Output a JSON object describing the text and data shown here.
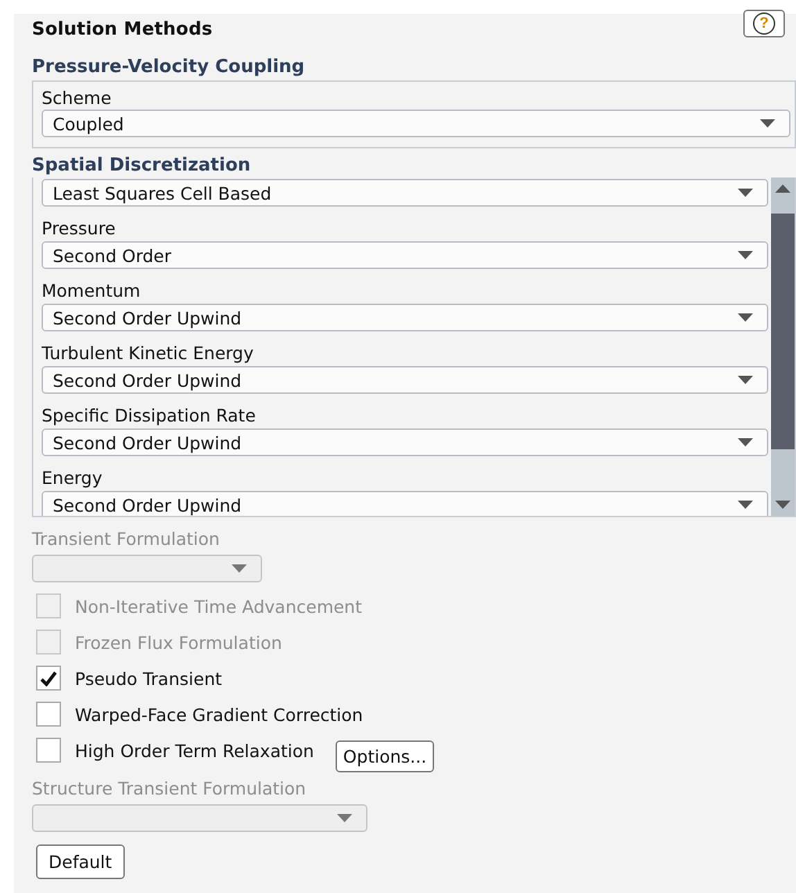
{
  "panel": {
    "title": "Solution Methods",
    "help_button": "?"
  },
  "pressure_velocity_coupling": {
    "heading": "Pressure-Velocity Coupling",
    "scheme": {
      "label": "Scheme",
      "value": "Coupled"
    }
  },
  "spatial_discretization": {
    "heading": "Spatial Discretization",
    "fields": [
      {
        "value": "Least Squares Cell Based"
      },
      {
        "label": "Pressure",
        "value": "Second Order"
      },
      {
        "label": "Momentum",
        "value": "Second Order Upwind"
      },
      {
        "label": "Turbulent Kinetic Energy",
        "value": "Second Order Upwind"
      },
      {
        "label": "Specific Dissipation Rate",
        "value": "Second Order Upwind"
      },
      {
        "label": "Energy",
        "value": "Second Order Upwind"
      }
    ]
  },
  "transient_formulation": {
    "label": "Transient Formulation",
    "disabled": true
  },
  "options": [
    {
      "label": "Non-Iterative Time Advancement",
      "checked": false,
      "disabled": true
    },
    {
      "label": "Frozen Flux Formulation",
      "checked": false,
      "disabled": true
    },
    {
      "label": "Pseudo Transient",
      "checked": true,
      "disabled": false
    },
    {
      "label": "Warped-Face Gradient Correction",
      "checked": false,
      "disabled": false
    },
    {
      "label": "High Order Term Relaxation",
      "checked": false,
      "disabled": false
    }
  ],
  "options_button": "Options...",
  "structure_transient_formulation": {
    "label": "Structure Transient Formulation",
    "disabled": true
  },
  "default_button": "Default"
}
